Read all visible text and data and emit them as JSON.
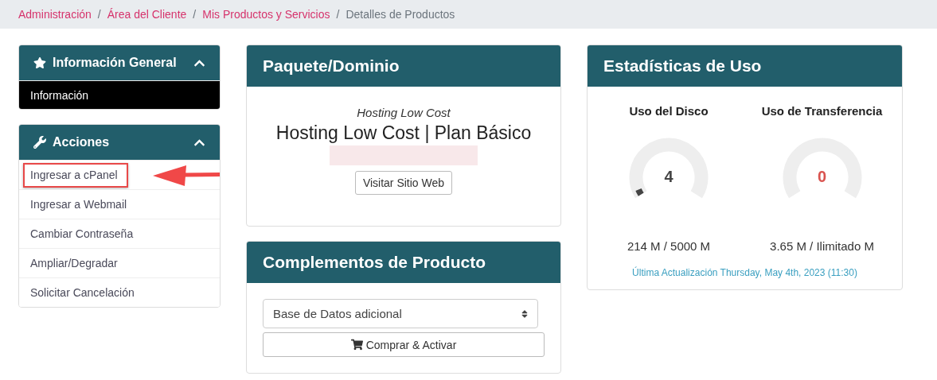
{
  "breadcrumb": [
    {
      "label": "Administración",
      "current": false
    },
    {
      "separator": "/",
      "label": "Área del Cliente",
      "current": false
    },
    {
      "separator": "/",
      "label": "Mis Productos y Servicios",
      "current": false
    },
    {
      "separator": "/",
      "label": "Detalles de Productos",
      "current": true
    }
  ],
  "sidebar": [
    {
      "title": "Información General",
      "kind": "general",
      "expanded": true,
      "items": [
        {
          "label": "Información",
          "selected": true,
          "highlighted": false
        }
      ]
    },
    {
      "title": "Acciones",
      "kind": "actions",
      "expanded": true,
      "items": [
        {
          "label": "Ingresar a cPanel",
          "selected": false,
          "highlighted": true
        },
        {
          "label": "Ingresar a Webmail",
          "selected": false,
          "highlighted": false
        },
        {
          "label": "Cambiar Contraseña",
          "selected": false,
          "highlighted": false
        },
        {
          "label": "Ampliar/Degradar",
          "selected": false,
          "highlighted": false
        },
        {
          "label": "Solicitar Cancelación",
          "selected": false,
          "highlighted": false
        }
      ]
    }
  ],
  "package": {
    "title": "Paquete/Dominio",
    "group": "Hosting Low Cost",
    "product": "Hosting Low Cost | Plan Básico",
    "button": "Visitar Sitio Web"
  },
  "addons": {
    "title": "Complementos de Producto",
    "select": {
      "value": "Base de Datos adicional"
    },
    "button": "Comprar & Activar"
  },
  "usage": {
    "title": "Estadísticas de Uso",
    "gauges": [
      {
        "label": "Uso del Disco",
        "value": "4",
        "level": 0.04,
        "color": "#444444",
        "reading": "214 M / 5000 M"
      },
      {
        "label": "Uso de Transferencia",
        "value": "0",
        "color": "#d9534f",
        "reading": "3.65 M / Ilimitado M"
      }
    ],
    "updated": "Última Actualización Thursday, May 4th, 2023 (11:30)"
  }
}
